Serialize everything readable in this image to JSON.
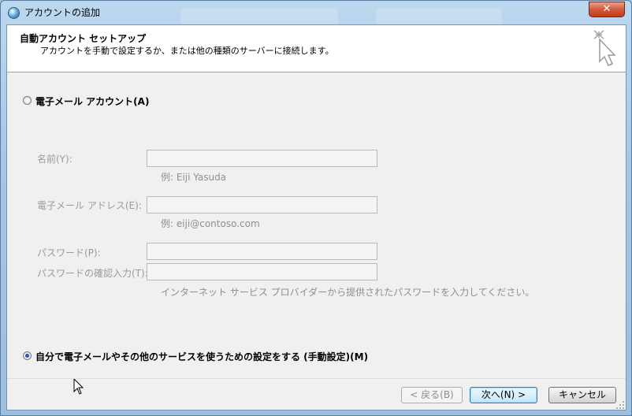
{
  "window": {
    "title": "アカウントの追加",
    "close_label": "✕"
  },
  "header": {
    "title": "自動アカウント セットアップ",
    "subtitle": "アカウントを手動で設定するか、または他の種類のサーバーに接続します。"
  },
  "options": {
    "email_account": {
      "label": "電子メール アカウント(A)",
      "selected": false
    },
    "manual_setup": {
      "label": "自分で電子メールやその他のサービスを使うための設定をする (手動設定)(M)",
      "selected": true
    }
  },
  "form": {
    "name": {
      "label": "名前(Y):",
      "value": "",
      "hint": "例: Eiji Yasuda"
    },
    "email": {
      "label": "電子メール アドレス(E):",
      "value": "",
      "hint": "例: eiji@contoso.com"
    },
    "password": {
      "label": "パスワード(P):",
      "value": ""
    },
    "password_confirm": {
      "label": "パスワードの確認入力(T):",
      "value": ""
    },
    "password_hint": "インターネット サービス プロバイダーから提供されたパスワードを入力してください。"
  },
  "buttons": {
    "back": "< 戻る(B)",
    "next": "次へ(N) >",
    "cancel": "キャンセル"
  },
  "colors": {
    "accent": "#1f5da8",
    "disabled_text": "#9a9a9a"
  }
}
